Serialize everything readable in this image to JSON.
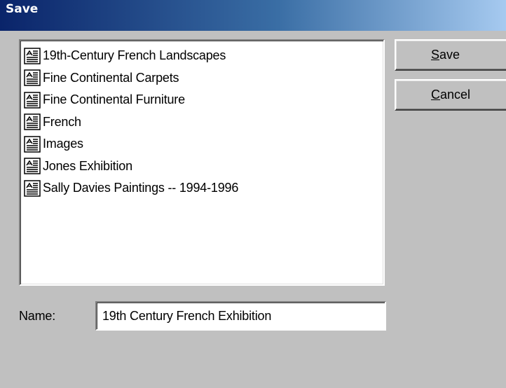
{
  "window": {
    "title": "Save"
  },
  "file_list": {
    "items": [
      {
        "label": "19th-Century French Landscapes",
        "icon": "document-icon"
      },
      {
        "label": "Fine Continental Carpets",
        "icon": "document-icon"
      },
      {
        "label": "Fine Continental Furniture",
        "icon": "document-icon"
      },
      {
        "label": "French",
        "icon": "document-icon"
      },
      {
        "label": "Images",
        "icon": "document-icon"
      },
      {
        "label": "Jones Exhibition",
        "icon": "document-icon"
      },
      {
        "label": "Sally Davies Paintings -- 1994-1996",
        "icon": "document-icon"
      }
    ]
  },
  "buttons": {
    "save": {
      "mnemonic": "S",
      "rest": "ave"
    },
    "cancel": {
      "mnemonic": "C",
      "rest": "ancel"
    }
  },
  "name_field": {
    "label": "Name:",
    "value": "19th Century French Exhibition"
  },
  "colors": {
    "title_bar_start": "#0a246a",
    "title_bar_end": "#a6caf0",
    "dialog_background": "#c0c0c0",
    "list_background": "#ffffff"
  }
}
